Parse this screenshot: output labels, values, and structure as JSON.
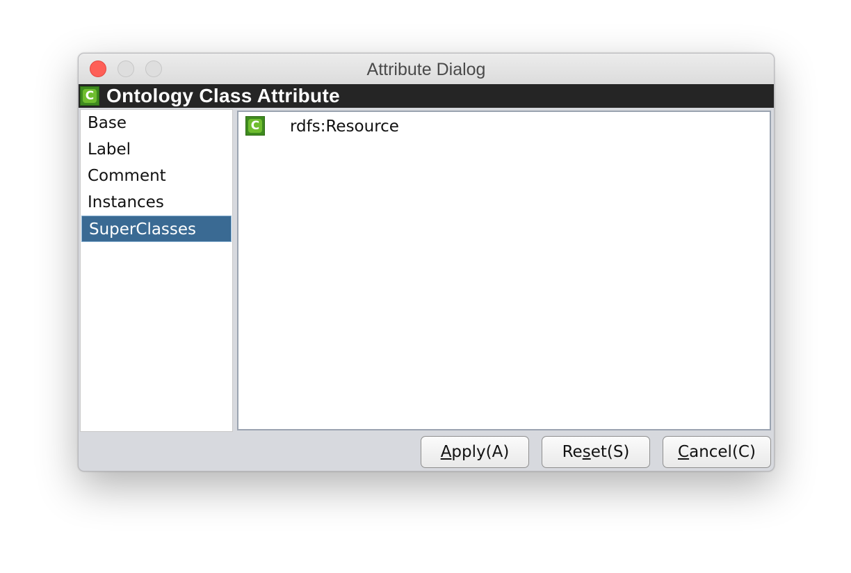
{
  "window": {
    "title": "Attribute Dialog"
  },
  "header": {
    "icon_letter": "C",
    "title": "Ontology Class Attribute"
  },
  "sidebar": {
    "items": [
      {
        "label": "Base"
      },
      {
        "label": "Label"
      },
      {
        "label": "Comment"
      },
      {
        "label": "Instances"
      },
      {
        "label": "SuperClasses"
      }
    ],
    "selected": "SuperClasses"
  },
  "content": {
    "rows": [
      {
        "icon_letter": "C",
        "label": "rdfs:Resource"
      }
    ]
  },
  "buttons": {
    "apply": {
      "mnemonic": "A",
      "rest": "pply(A)"
    },
    "reset": {
      "pre": "Re",
      "mnemonic": "s",
      "rest": "et(S)"
    },
    "cancel": {
      "mnemonic": "C",
      "rest": "ancel(C)"
    }
  },
  "colors": {
    "header_bg": "#252525",
    "selection_bg": "#3a6a93",
    "class_icon_green": "#6fbd2f",
    "close_red": "#fe5f57"
  },
  "icons": [
    "close-icon",
    "minimize-icon",
    "maximize-icon",
    "class-icon"
  ]
}
